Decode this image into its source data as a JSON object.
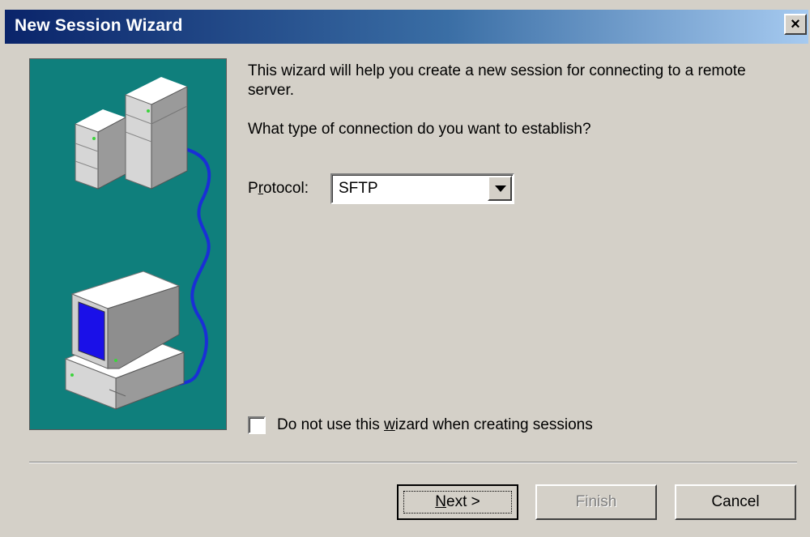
{
  "window": {
    "title": "New Session Wizard",
    "close_label": "×"
  },
  "content": {
    "intro": "This wizard will help you create a new session for connecting to a remote server.",
    "question": "What type of connection do you want to establish?",
    "protocol_label_prefix": "P",
    "protocol_label_underlined": "r",
    "protocol_label_suffix": "otocol:",
    "protocol_value": "SFTP"
  },
  "checkbox": {
    "label_prefix": "Do not use this ",
    "label_underlined": "w",
    "label_suffix": "izard when creating sessions",
    "checked": false
  },
  "buttons": {
    "next_underlined": "N",
    "next_suffix": "ext >",
    "finish": "Finish",
    "cancel": "Cancel"
  },
  "colors": {
    "titlebar_start": "#0a246a",
    "titlebar_end": "#a6caf0",
    "panel_background": "#0f7f7c",
    "window_background": "#d4d0c8"
  },
  "icons": {
    "art_servers": "server-tower-icon",
    "art_computer": "desktop-computer-icon",
    "art_cable": "network-cable-icon"
  }
}
